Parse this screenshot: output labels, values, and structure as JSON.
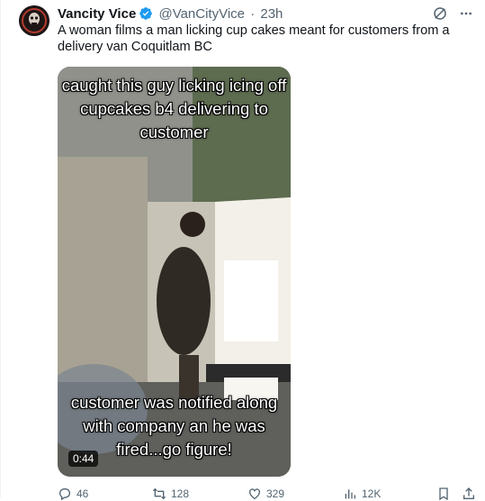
{
  "tweet": {
    "author_name": "Vancity Vice",
    "handle": "@VanCityVice",
    "separator": "·",
    "time": "23h",
    "text": "A woman films a man licking cup cakes meant for customers from a delivery van Coquitlam BC",
    "verified_color": "#1d9bf0"
  },
  "media": {
    "caption_top": "caught this guy licking icing off cupcakes b4 delivering to customer",
    "caption_bottom": "customer was notified along with company an he was fired...go figure!",
    "duration": "0:44"
  },
  "actions": {
    "replies": "46",
    "reposts": "128",
    "likes": "329",
    "views": "12K"
  },
  "icons": {
    "grok": "grok-icon",
    "more": "more-icon",
    "reply": "reply-icon",
    "repost": "repost-icon",
    "like": "like-icon",
    "views": "views-icon",
    "bookmark": "bookmark-icon",
    "share": "share-icon"
  }
}
